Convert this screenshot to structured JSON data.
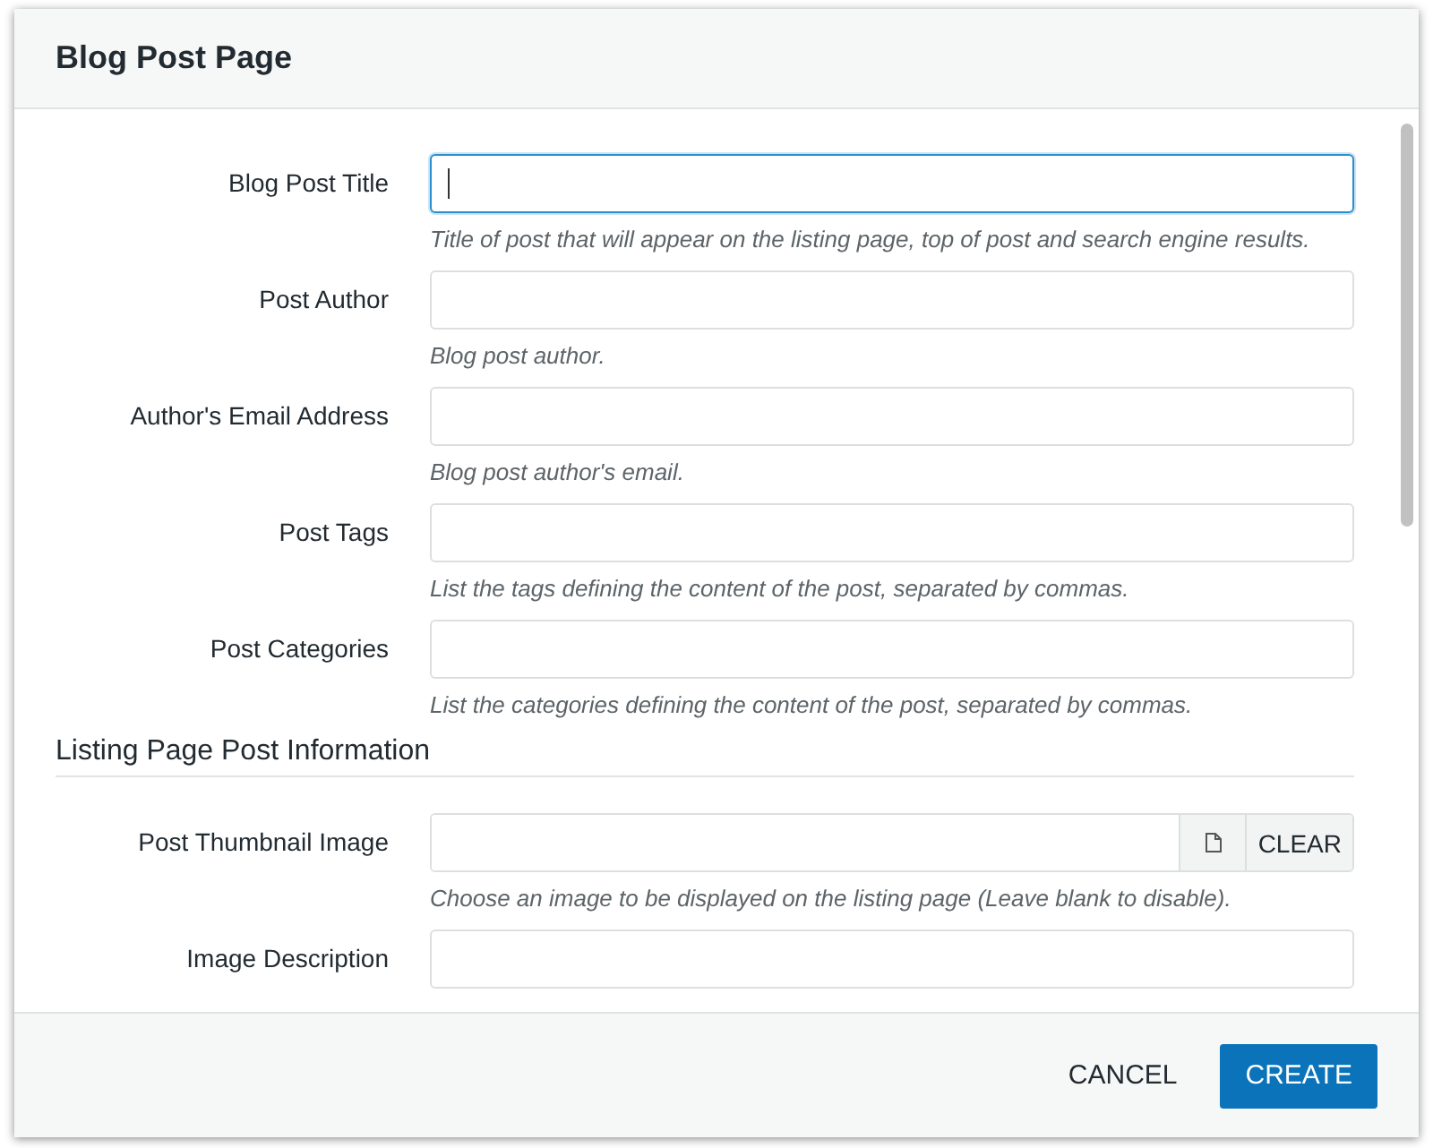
{
  "dialog": {
    "title": "Blog Post Page"
  },
  "sections": [
    {
      "fields": [
        {
          "kind": "text",
          "label": "Blog Post Title",
          "focused": true,
          "help": "Title of post that will appear on the listing page, top of post and search engine results."
        },
        {
          "kind": "text",
          "label": "Post Author",
          "focused": false,
          "help": "Blog post author."
        },
        {
          "kind": "text",
          "label": "Author's Email Address",
          "focused": false,
          "help": "Blog post author's email."
        },
        {
          "kind": "text",
          "label": "Post Tags",
          "focused": false,
          "help": "List the tags defining the content of the post, separated by commas."
        },
        {
          "kind": "text",
          "label": "Post Categories",
          "focused": false,
          "help": "List the categories defining the content of the post, separated by commas."
        }
      ]
    },
    {
      "heading": "Listing Page Post Information",
      "fields": [
        {
          "kind": "file",
          "label": "Post Thumbnail Image",
          "focused": false,
          "clear_label": "CLEAR",
          "help": "Choose an image to be displayed on the listing page (Leave blank to disable)."
        },
        {
          "kind": "text",
          "label": "Image Description",
          "focused": false
        }
      ]
    }
  ],
  "buttons": [
    {
      "kind": "secondary",
      "label": "CANCEL"
    },
    {
      "kind": "primary",
      "label": "CREATE"
    }
  ]
}
